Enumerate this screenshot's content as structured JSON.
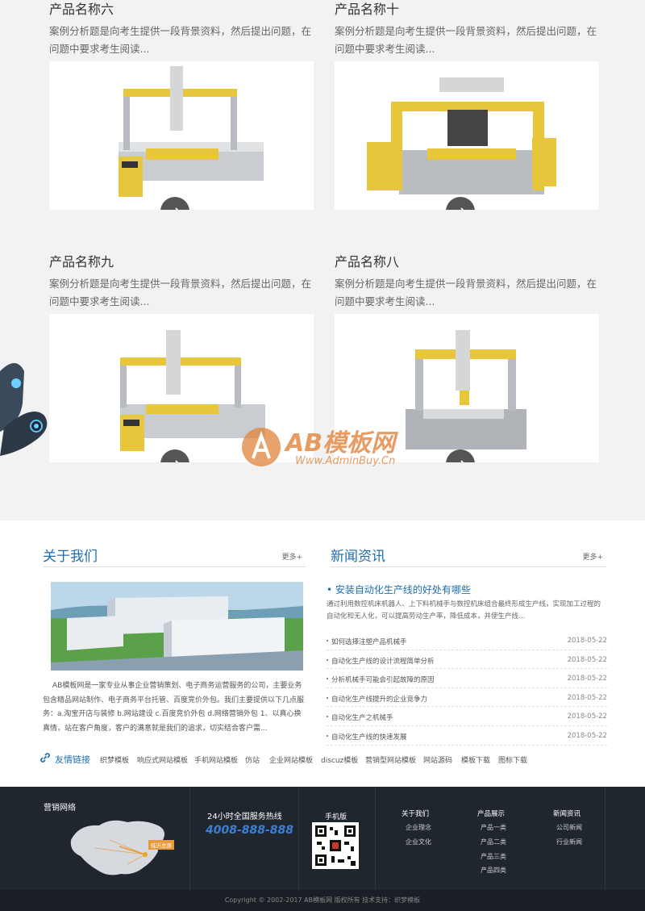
{
  "products": [
    {
      "title": "产品名称六",
      "desc": "案例分析题是向考生提供一段背景资料，然后提出问题，在问题中要求考生阅读..."
    },
    {
      "title": "产品名称十",
      "desc": "案例分析题是向考生提供一段背景资料，然后提出问题，在问题中要求考生阅读..."
    },
    {
      "title": "产品名称九",
      "desc": "案例分析题是向考生提供一段背景资料，然后提出问题，在问题中要求考生阅读..."
    },
    {
      "title": "产品名称八",
      "desc": "案例分析题是向考生提供一段背景资料，然后提出问题，在问题中要求考生阅读..."
    }
  ],
  "watermark": {
    "brand": "AB模板网",
    "url": "Www.AdminBuy.Cn"
  },
  "about": {
    "title": "关于我们",
    "more": "更多+",
    "text": "AB模板网是一家专业从事企业营销策划、电子商务运营服务的公司，主要业务包含精品网站制作、电子商务平台托管、百度竞价外包。我们主要提供以下几点服务：a.淘宝开店与装修 b.网站建设 c.百度竞价外包 d.网络营销外包 1、以真心换真情，站在客户角度，客户的满意就是我们的追求，切实结合客户需..."
  },
  "news": {
    "title": "新闻资讯",
    "more": "更多+",
    "top_title": "• 安装自动化生产线的好处有哪些",
    "top_desc": "通过利用数控机床机器人、上下料机械手与数控机床组合最终形成生产线，实现加工过程的自动化和无人化，可以提高劳动生产率，降低成本，并使生产线...",
    "items": [
      {
        "title": "如何选择注塑产品机械手",
        "date": "2018-05-22"
      },
      {
        "title": "自动化生产线的设计流程简单分析",
        "date": "2018-05-22"
      },
      {
        "title": "分析机械手可能会引起故障的原因",
        "date": "2018-05-22"
      },
      {
        "title": "自动化生产线提升的企业竞争力",
        "date": "2018-05-22"
      },
      {
        "title": "自动化生产之机械手",
        "date": "2018-05-22"
      },
      {
        "title": "自动化生产线的快速发展",
        "date": "2018-05-22"
      }
    ]
  },
  "links": {
    "label": "友情链接",
    "items": [
      "织梦模板",
      "响应式网站模板",
      "手机网站模板",
      "仿站",
      "企业网站模板",
      "discuz模板",
      "营销型网站模板",
      "网站源码",
      "模板下载",
      "图标下载"
    ]
  },
  "footer": {
    "network_title": "营销网络",
    "map_label": "临沂总部",
    "hotline_title": "24小时全国服务热线",
    "hotline": "4008-888-888",
    "mobile_title": "手机版",
    "cols": [
      {
        "title": "关于我们",
        "items": [
          "企业理念",
          "企业文化"
        ]
      },
      {
        "title": "产品展示",
        "items": [
          "产品一类",
          "产品二类",
          "产品三类",
          "产品四类"
        ]
      },
      {
        "title": "新闻资讯",
        "items": [
          "公司新闻",
          "行业新闻"
        ]
      }
    ],
    "copyright": "Copyright © 2002-2017 AB模板网 版权所有 技术支持：织梦模板"
  },
  "colors": {
    "accent": "#1e6db0",
    "footer_bg": "#20262e",
    "hotline": "#3b7fd6"
  }
}
